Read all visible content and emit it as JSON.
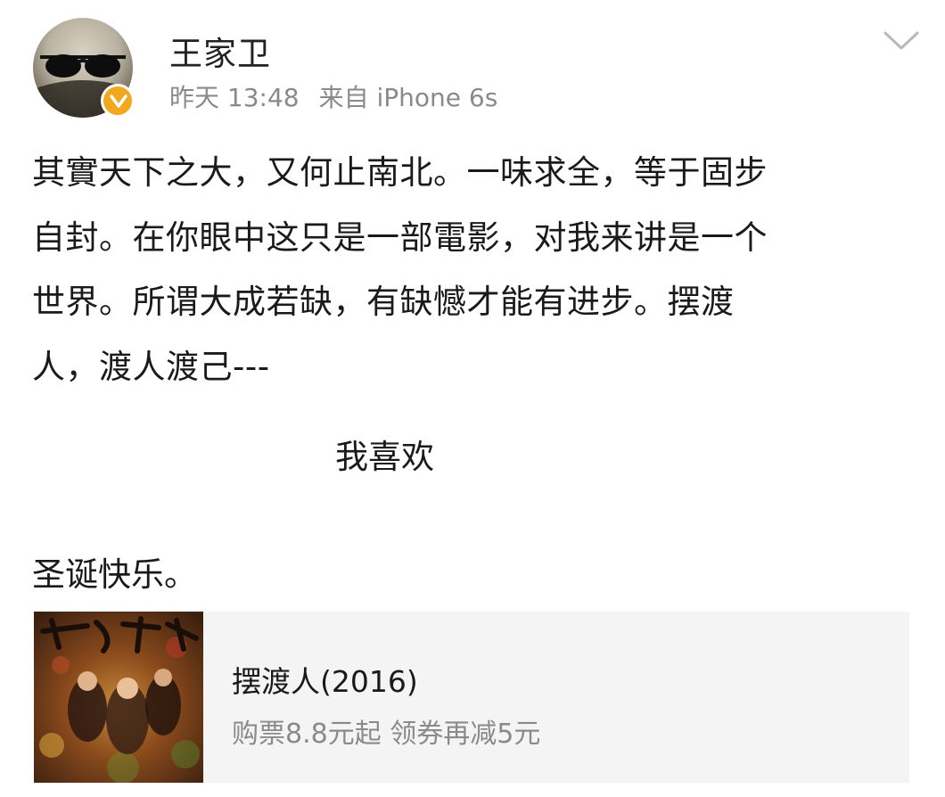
{
  "post": {
    "author": {
      "name": "王家卫",
      "avatar_icon": "sunglasses-avatar",
      "verified_icon": "verified-badge-icon",
      "verified_color": "#f2a81d"
    },
    "timestamp": "昨天 13:48",
    "source": "来自 iPhone 6s",
    "menu_icon": "chevron-down-icon",
    "text_lines": [
      "其實天下之大，又何止南北。一味求全，等于固步",
      "自封。在你眼中这只是一部電影，对我来讲是一个",
      "世界。所谓大成若缺，有缺憾才能有进步。摆渡",
      "人，渡人渡己---"
    ],
    "centered_line": "我喜欢",
    "closing_line": "圣诞快乐。"
  },
  "movie_card": {
    "poster_icon": "movie-poster",
    "title": "摆渡人(2016)",
    "promo": "购票8.8元起 领券再减5元"
  }
}
